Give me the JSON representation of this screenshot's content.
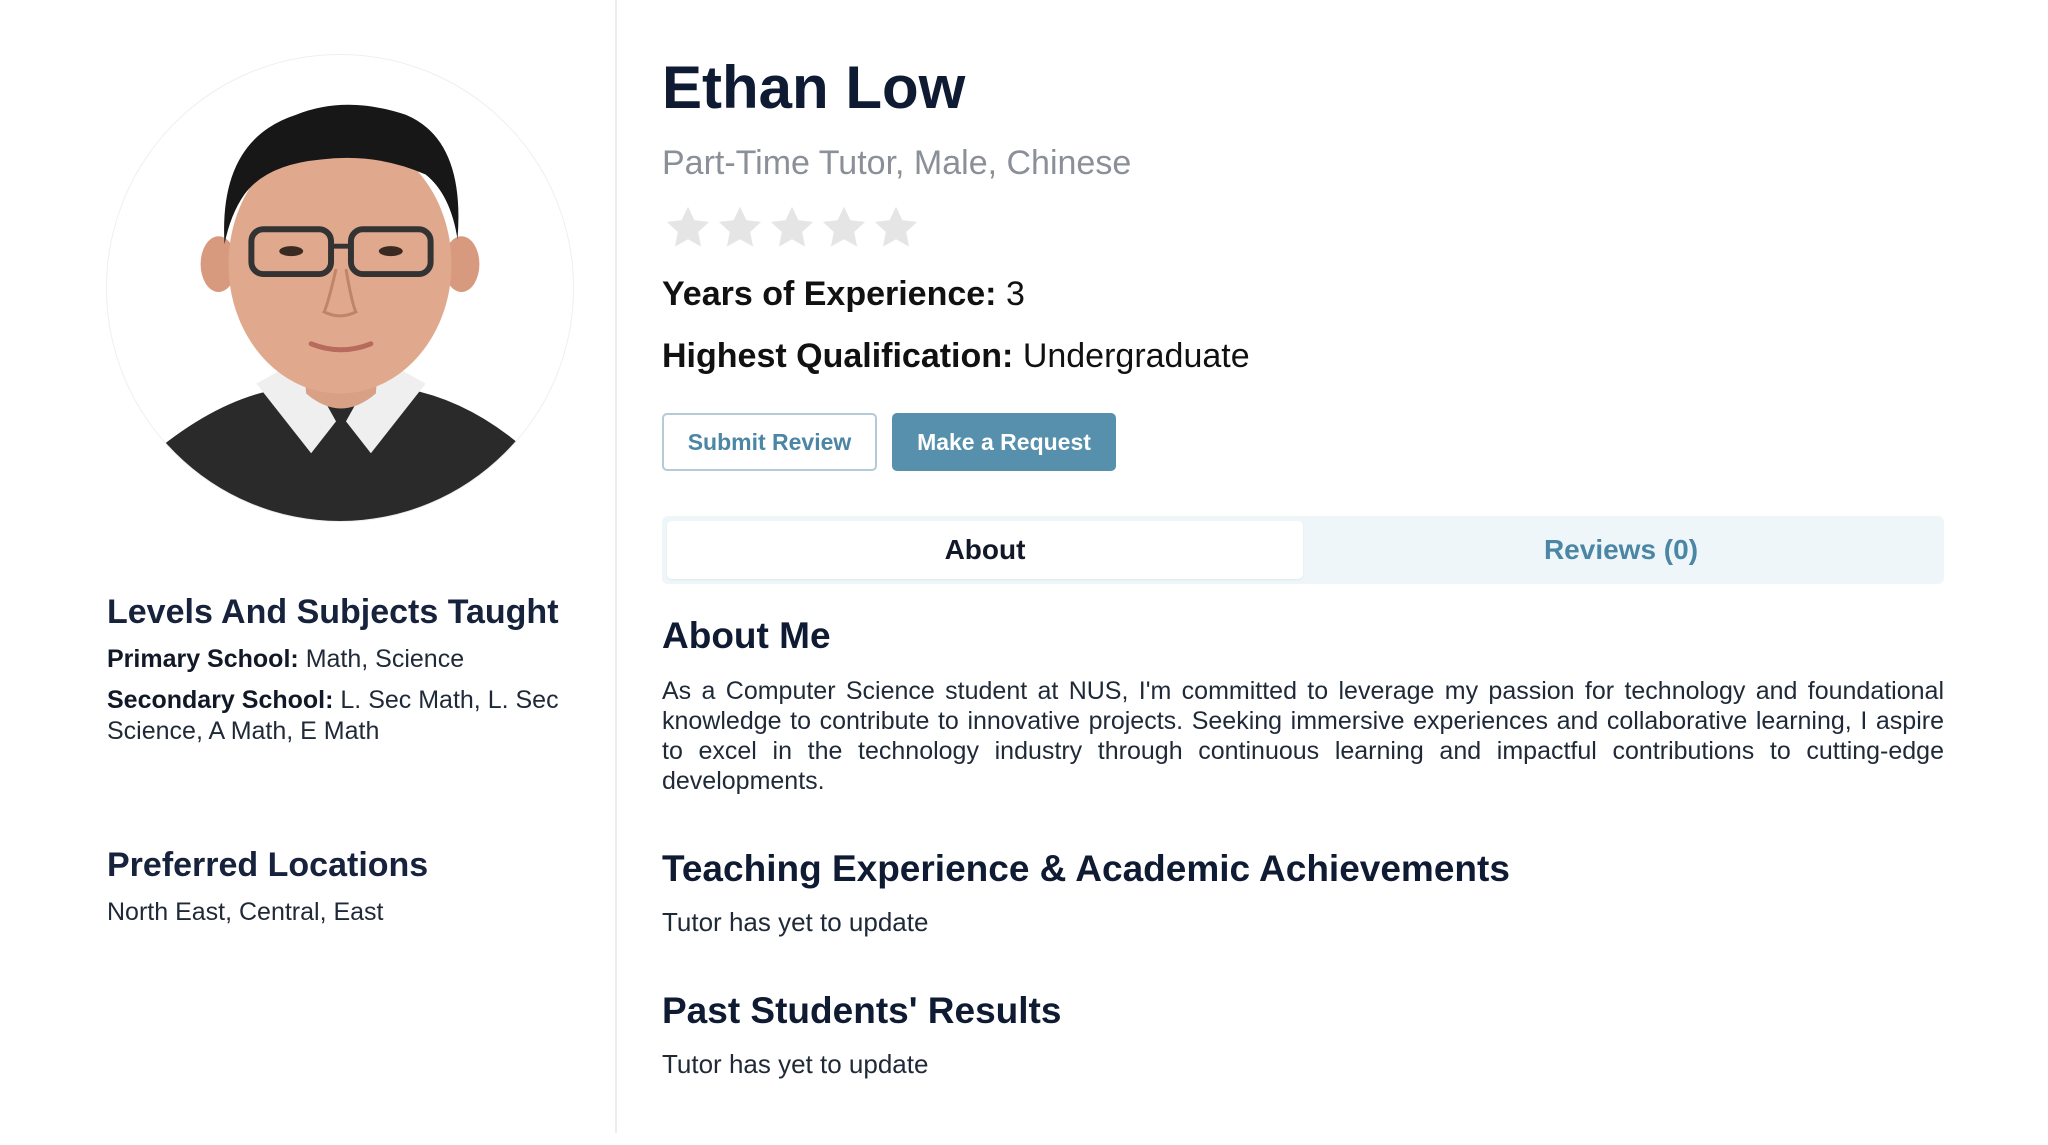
{
  "tutor": {
    "name": "Ethan Low",
    "subtitle": "Part-Time Tutor, Male, Chinese",
    "rating_stars_filled": 0,
    "rating_stars_total": 5,
    "experience_label": "Years of Experience:",
    "experience_value": "3",
    "qualification_label": "Highest Qualification:",
    "qualification_value": "Undergraduate"
  },
  "actions": {
    "submit_review_label": "Submit Review",
    "make_request_label": "Make a Request"
  },
  "tabs": [
    {
      "label": "About",
      "active": true
    },
    {
      "label": "Reviews (0)",
      "active": false
    }
  ],
  "sidebar": {
    "levels_title": "Levels And Subjects Taught",
    "levels": [
      {
        "label": "Primary School:",
        "value": "Math, Science"
      },
      {
        "label": "Secondary School:",
        "value": "L. Sec Math, L. Sec Science, A Math, E Math"
      }
    ],
    "locations_title": "Preferred Locations",
    "locations_value": "North East, Central, East"
  },
  "about": {
    "title": "About Me",
    "text": "As a Computer Science student at NUS, I'm committed to leverage my passion for technology and foundational knowledge to contribute to innovative projects. Seeking immersive experiences and collaborative learning, I aspire to excel in the technology industry through continuous learning and impactful contributions to cutting-edge developments.",
    "teaching_title": "Teaching Experience & Academic Achievements",
    "teaching_text": "Tutor has yet to update",
    "results_title": "Past Students' Results",
    "results_text": "Tutor has yet to update"
  },
  "colors": {
    "accent": "#5690ad",
    "accent_text": "#4b86a4",
    "tab_bg": "#eef6fa",
    "star_empty": "#e5e5e5",
    "heading": "#0f1b33",
    "muted": "#8a8f98"
  },
  "icons": {
    "star": "star-icon",
    "avatar": "profile-photo"
  }
}
